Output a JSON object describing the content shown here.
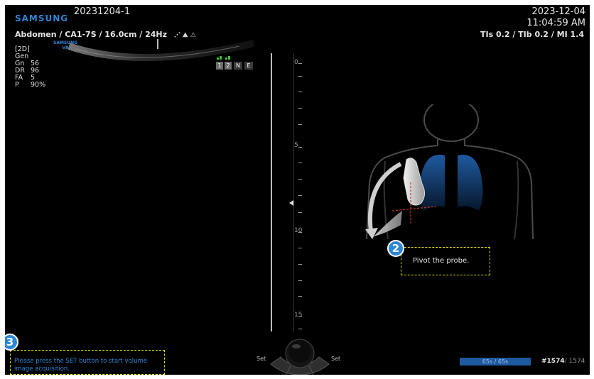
{
  "header": {
    "brand": "SAMSUNG",
    "patient_id": "20231204-1",
    "date": "2023-12-04",
    "time": "11:04:59 AM",
    "probe_line": "Abdomen / CA1-7S / 16.0cm / 24Hz",
    "indices": "TIs 0.2 / TIb 0.2 / MI 1.4"
  },
  "mini_logo": {
    "line1": "SAMSUNG",
    "line2": "V8"
  },
  "params": {
    "mode": "[2D]",
    "preset": "Gen",
    "rows": [
      {
        "key": "Gn",
        "value": "56"
      },
      {
        "key": "DR",
        "value": "96"
      },
      {
        "key": "FA",
        "value": "5"
      },
      {
        "key": "P",
        "value": "90%"
      }
    ]
  },
  "focus_buttons": [
    "1",
    "2",
    "N",
    "E"
  ],
  "ruler": {
    "labels": [
      "0",
      "5",
      "10",
      "15"
    ]
  },
  "guide": {
    "step_number": "2",
    "instruction": "Pivot the probe."
  },
  "message": {
    "step_number": "3",
    "text": "Please press the SET button to start volume image acquisition."
  },
  "trackball": {
    "left_label": "Set",
    "right_label": "Set"
  },
  "progress": {
    "label": "65s / 65s",
    "fraction": 1.0
  },
  "frame": {
    "current": "#1574",
    "total": "/ 1574"
  },
  "colors": {
    "brand": "#2d86d6",
    "callout": "#e8e000",
    "lung": "#1f5aa0"
  }
}
